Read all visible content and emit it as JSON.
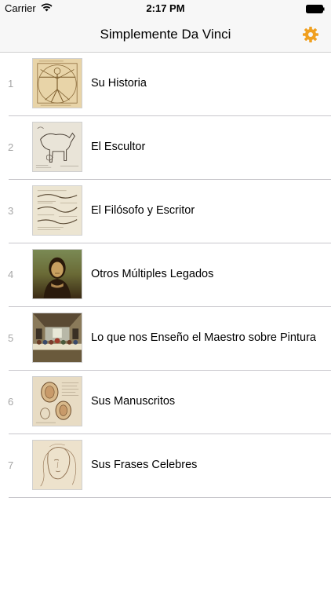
{
  "status_bar": {
    "carrier": "Carrier",
    "time": "2:17 PM",
    "wifi_icon": "wifi-icon",
    "battery_icon": "battery-icon"
  },
  "nav": {
    "title": "Simplemente Da Vinci",
    "settings_icon": "gear-icon",
    "accent_color": "#f0a020"
  },
  "items": [
    {
      "index": "1",
      "label": "Su Historia",
      "thumbnail": "vitruvian-man-thumbnail"
    },
    {
      "index": "2",
      "label": "El Escultor",
      "thumbnail": "horse-sketch-thumbnail"
    },
    {
      "index": "3",
      "label": "El Filósofo y Escritor",
      "thumbnail": "manuscript-sketch-thumbnail"
    },
    {
      "index": "4",
      "label": "Otros Múltiples Legados",
      "thumbnail": "mona-lisa-thumbnail"
    },
    {
      "index": "5",
      "label": "Lo que nos Enseño el Maestro sobre Pintura",
      "thumbnail": "last-supper-thumbnail"
    },
    {
      "index": "6",
      "label": "Sus Manuscritos",
      "thumbnail": "anatomical-sketch-thumbnail"
    },
    {
      "index": "7",
      "label": "Sus Frases Celebres",
      "thumbnail": "portrait-sketch-thumbnail"
    }
  ]
}
